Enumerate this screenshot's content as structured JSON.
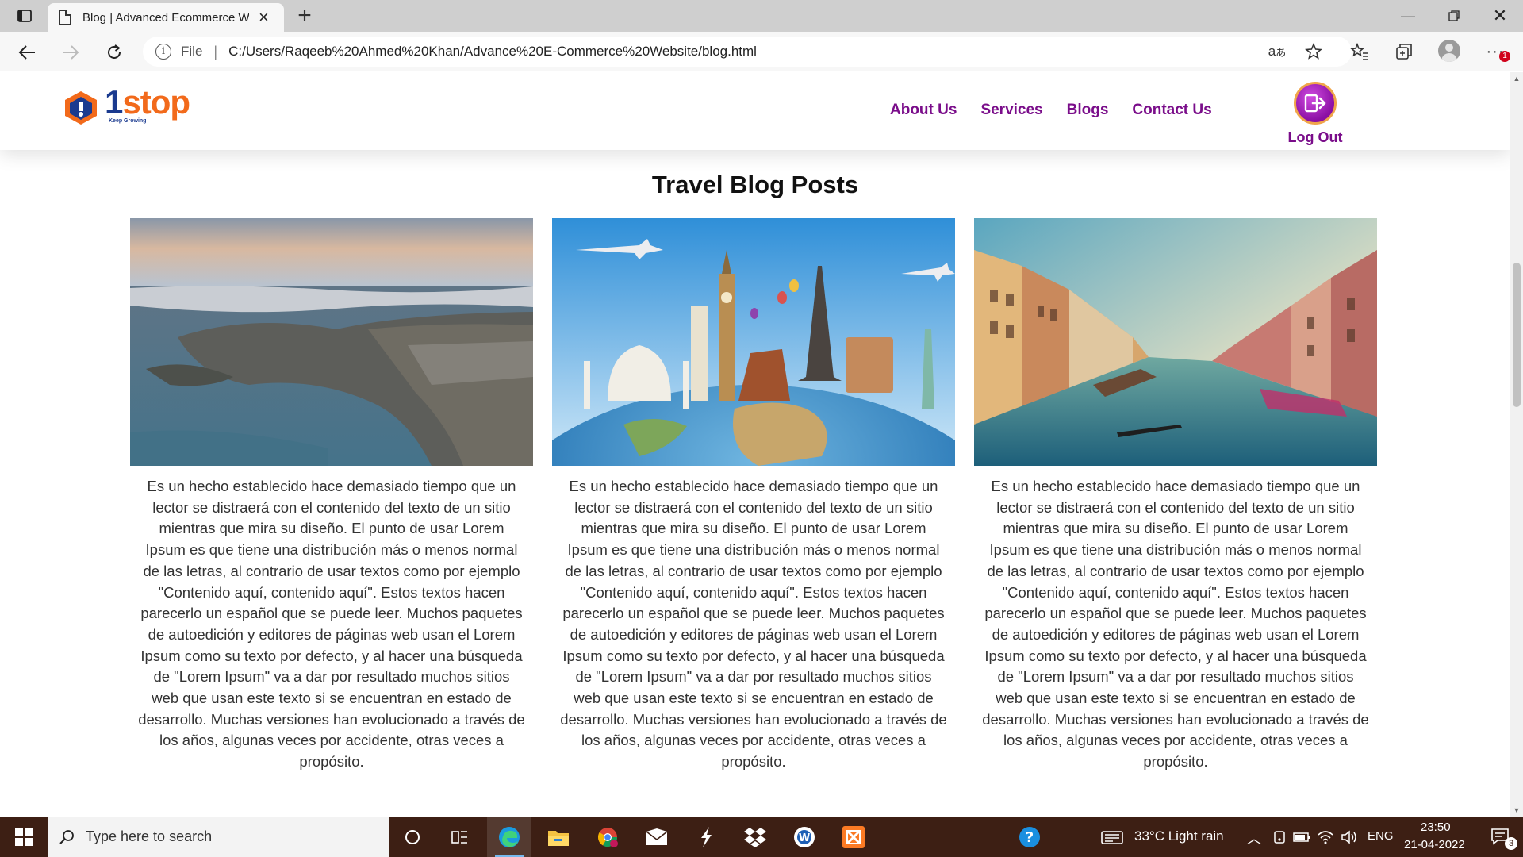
{
  "browser": {
    "tab_title": "Blog | Advanced Ecommerce Website",
    "file_label": "File",
    "url": "C:/Users/Raqeeb%20Ahmed%20Khan/Advance%20E-Commerce%20Website/blog.html",
    "notification_count": "1"
  },
  "site": {
    "logo_one": "1",
    "logo_rest": "stop",
    "logo_tagline": "Keep Growing",
    "nav": [
      {
        "label": "About Us"
      },
      {
        "label": "Services"
      },
      {
        "label": "Blogs"
      },
      {
        "label": "Contact Us"
      }
    ],
    "logout_label": "Log Out",
    "page_title": "Travel Blog Posts"
  },
  "posts": [
    {
      "image": "aerial-coastline-photo",
      "text": "Es un hecho establecido hace demasiado tiempo que un lector se distraerá con el contenido del texto de un sitio mientras que mira su diseño. El punto de usar Lorem Ipsum es que tiene una distribución más o menos normal de las letras, al contrario de usar textos como por ejemplo \"Contenido aquí, contenido aquí\". Estos textos hacen parecerlo un español que se puede leer. Muchos paquetes de autoedición y editores de páginas web usan el Lorem Ipsum como su texto por defecto, y al hacer una búsqueda de \"Lorem Ipsum\" va a dar por resultado muchos sitios web que usan este texto si se encuentran en estado de desarrollo. Muchas versiones han evolucionado a través de los años, algunas veces por accidente, otras veces a propósito."
    },
    {
      "image": "world-landmarks-globe-photo",
      "text": "Es un hecho establecido hace demasiado tiempo que un lector se distraerá con el contenido del texto de un sitio mientras que mira su diseño. El punto de usar Lorem Ipsum es que tiene una distribución más o menos normal de las letras, al contrario de usar textos como por ejemplo \"Contenido aquí, contenido aquí\". Estos textos hacen parecerlo un español que se puede leer. Muchos paquetes de autoedición y editores de páginas web usan el Lorem Ipsum como su texto por defecto, y al hacer una búsqueda de \"Lorem Ipsum\" va a dar por resultado muchos sitios web que usan este texto si se encuentran en estado de desarrollo. Muchas versiones han evolucionado a través de los años, algunas veces por accidente, otras veces a propósito."
    },
    {
      "image": "venice-canal-photo",
      "text": "Es un hecho establecido hace demasiado tiempo que un lector se distraerá con el contenido del texto de un sitio mientras que mira su diseño. El punto de usar Lorem Ipsum es que tiene una distribución más o menos normal de las letras, al contrario de usar textos como por ejemplo \"Contenido aquí, contenido aquí\". Estos textos hacen parecerlo un español que se puede leer. Muchos paquetes de autoedición y editores de páginas web usan el Lorem Ipsum como su texto por defecto, y al hacer una búsqueda de \"Lorem Ipsum\" va a dar por resultado muchos sitios web que usan este texto si se encuentran en estado de desarrollo. Muchas versiones han evolucionado a través de los años, algunas veces por accidente, otras veces a propósito."
    }
  ],
  "taskbar": {
    "search_placeholder": "Type here to search",
    "weather": "33°C  Light rain",
    "language": "ENG",
    "time": "23:50",
    "date": "21-04-2022",
    "notifications": "3"
  },
  "colors": {
    "nav_purple": "#7a0d8a",
    "logo_orange": "#f26a1b",
    "taskbar_bg": "#3d1f14"
  }
}
